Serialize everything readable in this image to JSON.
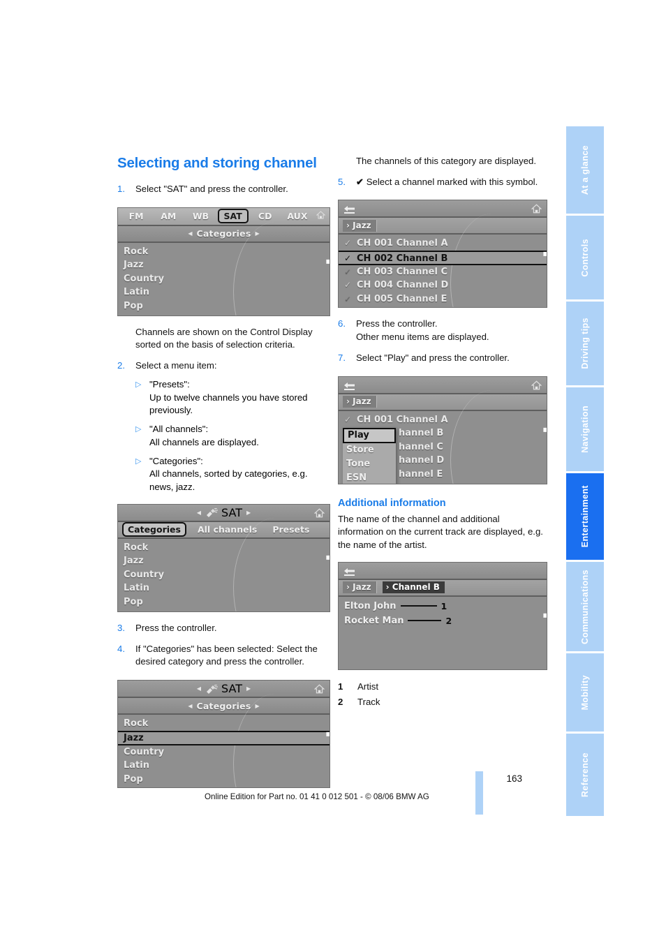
{
  "page": {
    "number": "163",
    "footer_line": "Online Edition for Part no. 01 41 0 012 501 - © 08/06 BMW AG"
  },
  "sidebar": {
    "tabs": [
      {
        "label": "At a glance",
        "active": false
      },
      {
        "label": "Controls",
        "active": false
      },
      {
        "label": "Driving tips",
        "active": false
      },
      {
        "label": "Navigation",
        "active": false
      },
      {
        "label": "Entertainment",
        "active": true
      },
      {
        "label": "Communications",
        "active": false
      },
      {
        "label": "Mobility",
        "active": false
      },
      {
        "label": "Reference",
        "active": false
      }
    ],
    "accent_active": "#1a6ff0",
    "accent_inactive": "#aed2f7"
  },
  "left_column": {
    "title": "Selecting and storing channel",
    "step1": {
      "num": "1.",
      "text": "Select \"SAT\" and press the controller."
    },
    "screenshot1": {
      "bands": [
        "FM",
        "AM",
        "WB",
        "SAT",
        "CD",
        "AUX"
      ],
      "selected_band": "SAT",
      "header": "Categories",
      "list": [
        "Rock",
        "Jazz",
        "Country",
        "Latin",
        "Pop"
      ]
    },
    "caption1": "Channels are shown on the Control Display sorted on the basis of selection criteria.",
    "step2": {
      "num": "2.",
      "text": "Select a menu item:"
    },
    "bullets": [
      {
        "title": "\"Presets\":",
        "body": "Up to twelve channels you have stored previously."
      },
      {
        "title": "\"All channels\":",
        "body": "All channels are displayed."
      },
      {
        "title": "\"Categories\":",
        "body": "All channels, sorted by categories, e.g. news, jazz."
      }
    ],
    "screenshot2": {
      "header_title": "SAT",
      "tabs": [
        "Categories",
        "All channels",
        "Presets"
      ],
      "selected_tab": "Categories",
      "list": [
        "Rock",
        "Jazz",
        "Country",
        "Latin",
        "Pop"
      ]
    },
    "step3": {
      "num": "3.",
      "text": "Press the controller."
    },
    "step4": {
      "num": "4.",
      "text": "If \"Categories\" has been selected: Select the desired category and press the controller."
    },
    "screenshot3": {
      "header_title": "SAT",
      "subheader": "Categories",
      "list": [
        "Rock",
        "Jazz",
        "Country",
        "Latin",
        "Pop"
      ],
      "selected_item": "Jazz"
    }
  },
  "right_column": {
    "intro": "The channels of this category are displayed.",
    "step5": {
      "num": "5.",
      "icon": "check-icon",
      "text": "Select a channel marked with this symbol."
    },
    "screenshot4": {
      "breadcrumb": [
        "Jazz"
      ],
      "rows": [
        {
          "check": true,
          "label": "CH 001 Channel A",
          "selected": false
        },
        {
          "check": true,
          "label": "CH 002 Channel B",
          "selected": true
        },
        {
          "check": false,
          "label": "CH 003 Channel C",
          "selected": false
        },
        {
          "check": true,
          "label": "CH 004 Channel D",
          "selected": false
        },
        {
          "check": false,
          "label": "CH 005 Channel E",
          "selected": false
        }
      ]
    },
    "step6": {
      "num": "6.",
      "text": "Press the controller.",
      "text2": "Other menu items are displayed."
    },
    "step7": {
      "num": "7.",
      "text": "Select \"Play\" and press the controller."
    },
    "screenshot5": {
      "breadcrumb": [
        "Jazz"
      ],
      "rows": [
        {
          "check": true,
          "label": "CH 001 Channel A"
        },
        {
          "check": false,
          "label": "hannel B"
        },
        {
          "check": false,
          "label": "hannel C"
        },
        {
          "check": false,
          "label": "hannel D"
        },
        {
          "check": false,
          "label": "hannel E"
        }
      ],
      "popup_items": [
        "Play",
        "Store",
        "Tone",
        "ESN"
      ],
      "popup_selected": "Play"
    },
    "additional": {
      "heading": "Additional information",
      "body": "The name of the channel and additional information on the current track are displayed, e.g. the name of the artist."
    },
    "screenshot6": {
      "breadcrumb": [
        "Jazz",
        "Channel B"
      ],
      "lines": [
        {
          "text": "Elton John",
          "num": "1"
        },
        {
          "text": "Rocket Man",
          "num": "2"
        }
      ]
    },
    "legend": [
      {
        "num": "1",
        "label": "Artist"
      },
      {
        "num": "2",
        "label": "Track"
      }
    ]
  }
}
